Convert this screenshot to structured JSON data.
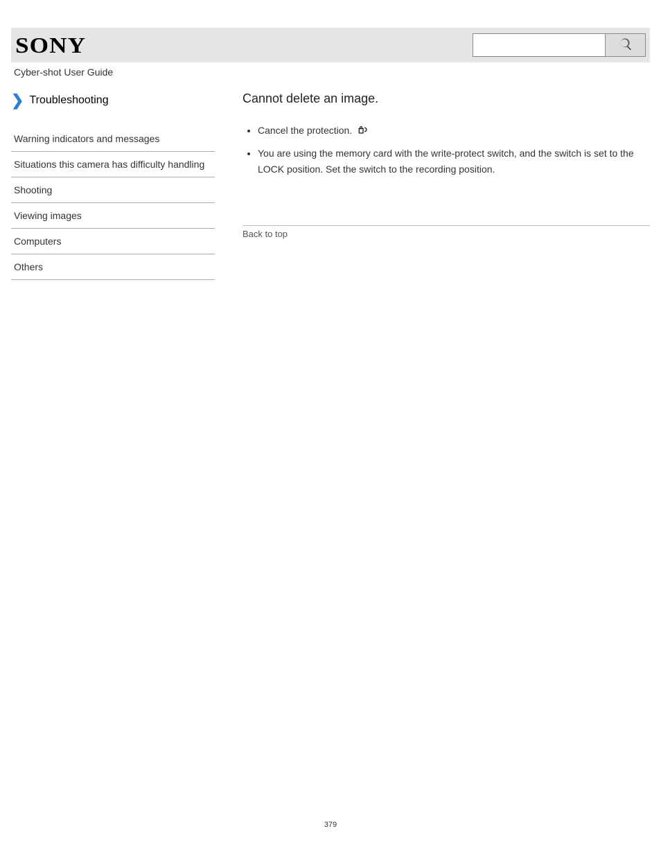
{
  "header": {
    "logo": "SONY",
    "search_value": "",
    "search_placeholder": ""
  },
  "user_guide_label": "Cyber-shot User Guide",
  "troubleshooting": {
    "title": "Troubleshooting"
  },
  "nav": {
    "items": [
      "Warning indicators and messages",
      "Situations this camera has difficulty handling",
      "Shooting",
      "Viewing images",
      "Computers",
      "Others"
    ]
  },
  "main": {
    "section_title": "Cannot delete an image.",
    "bullets": [
      {
        "pre": "Cancel the protection. ",
        "has_icon": true,
        "post": ""
      },
      {
        "pre": "You are using the memory card with the write-protect switch, and the switch is set to the LOCK position. Set the switch to the recording position.",
        "has_icon": false,
        "post": ""
      }
    ],
    "back_label": "Back to top"
  },
  "page_number": "379"
}
